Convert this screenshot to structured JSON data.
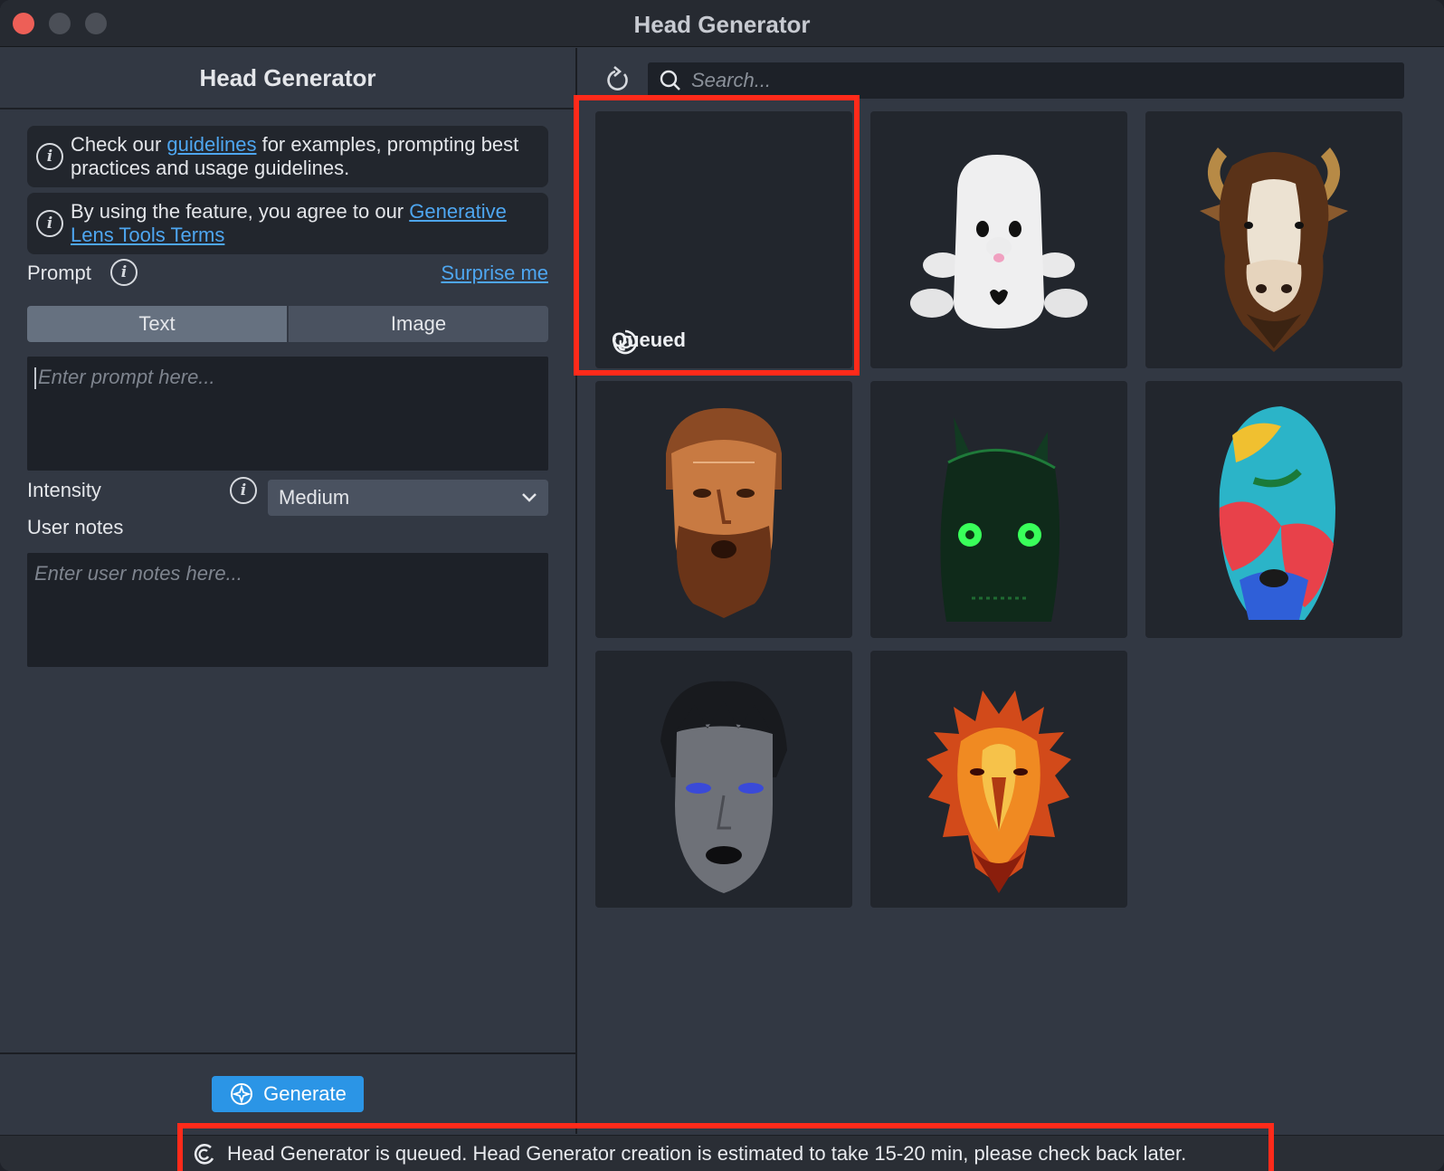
{
  "window": {
    "title": "Head Generator"
  },
  "left_panel": {
    "title": "Head Generator",
    "notice_guidelines": {
      "before": "Check our ",
      "link": "guidelines",
      "after": " for examples, prompting best practices and usage guidelines."
    },
    "notice_terms": {
      "before": "By using the feature, you agree to our ",
      "link": "Generative Lens Tools Terms"
    },
    "prompt_label": "Prompt",
    "surprise_link": "Surprise me",
    "tabs": [
      {
        "label": "Text",
        "active": true
      },
      {
        "label": "Image",
        "active": false
      }
    ],
    "prompt_placeholder": "Enter prompt here...",
    "intensity_label": "Intensity",
    "intensity_value": "Medium",
    "user_notes_label": "User notes",
    "user_notes_placeholder": "Enter user notes here...",
    "generate_label": "Generate"
  },
  "right_panel": {
    "search_placeholder": "Search...",
    "queued_label": "Queued",
    "tiles": [
      {
        "name": "queued",
        "icon": "queued-spinner-icon"
      },
      {
        "name": "ghost plush",
        "icon": "ghost-plush-head"
      },
      {
        "name": "bull",
        "icon": "bull-head"
      },
      {
        "name": "bronze man",
        "icon": "bronze-bearded-head"
      },
      {
        "name": "green cat",
        "icon": "dark-cat-green-eyes-head"
      },
      {
        "name": "parrot",
        "icon": "parrot-feather-head"
      },
      {
        "name": "woman",
        "icon": "gray-woman-head"
      },
      {
        "name": "fire bird",
        "icon": "fire-bird-head"
      }
    ]
  },
  "status_bar": {
    "message": "Head Generator is queued. Head Generator creation is estimated to take 15-20 min, please check back later."
  },
  "colors": {
    "accent": "#2b95e6",
    "highlight": "#ff2a1a",
    "link": "#4ea6f0"
  }
}
